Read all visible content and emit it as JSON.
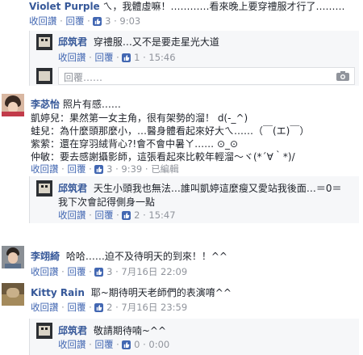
{
  "c1": {
    "name": "Violet Purple",
    "text": "ㄟ，我體虛嘛！…………看來晚上要穿禮服才行了………",
    "reply": "回覆",
    "likes": "3",
    "time": "9:03",
    "retract": "收回讚"
  },
  "r1": {
    "name": "邱筑君",
    "text": "穿禮服…又不是要走星光大道",
    "retract": "收回讚",
    "reply": "回覆",
    "likes": "1",
    "time": "15:46",
    "input_placeholder": "回覆……"
  },
  "c2": {
    "name": "李苾怡",
    "lines": [
      "照片有感……",
      "凱婷兒：果然第一女主角，很有架勢的溜！ d(-_^)",
      "蛙兒：為什麼頭那麼小，…醫身體看起來好大ㄟ……（￣(エ)￣）",
      "紫萦：還在穿羽絨背心?!會不會中暑ㄚ……  ⊙_⊙",
      "仲敏：要去感謝攝影師，這張看起來比較年輕溜～ヾ(*´∀｀*)/"
    ],
    "retract": "收回讚",
    "reply": "回覆",
    "likes": "3",
    "time": "9:39",
    "edited": "已編輯"
  },
  "r2": {
    "name": "邱筑君",
    "text1": "天生小頭我也無法…誰叫凱婷這麼瘦又愛站我後面…＝0＝",
    "text2": "我下次會記得側身一點",
    "retract": "收回讚",
    "reply": "回覆",
    "likes": "2",
    "time": "15:47"
  },
  "c3": {
    "name": "李翊綺",
    "text": "哈哈……迫不及待明天的到來！！^^",
    "retract": "收回讚",
    "reply": "回覆",
    "likes": "3",
    "time": "7月16日 22:09"
  },
  "c4": {
    "name": "Kitty Rain",
    "text": "耶~期待明天老師們的表演唷^^",
    "retract": "收回讚",
    "reply": "回覆",
    "likes": "2",
    "time": "7月16日 23:59"
  },
  "r3": {
    "name": "邱筑君",
    "text": "敬請期待喃~^^",
    "retract": "收回讚",
    "reply": "回覆",
    "likes": "0",
    "time": "0:00"
  },
  "separator": "·",
  "icons": {
    "like": "thumbs-up-icon",
    "camera": "camera-icon"
  },
  "colors": {
    "name": "#365899",
    "link": "#4267b2",
    "meta": "#90949c"
  }
}
